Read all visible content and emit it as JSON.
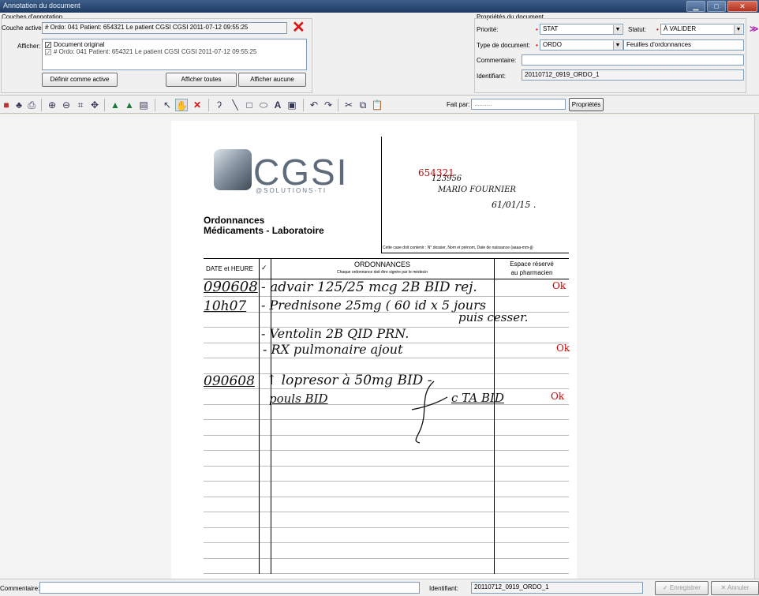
{
  "window": {
    "title": "Annotation du document"
  },
  "annotation": {
    "group_label": "Couches d'annotation",
    "active_layer_label": "Couche active:",
    "active_layer_value": "# Ordo: 041 Patient: 654321 Le patient CGSI CGSI 2011-07-12 09:55:25",
    "show_label": "Afficher:",
    "layers": [
      {
        "label": "Document original",
        "checked": true
      },
      {
        "label": "# Ordo: 041 Patient: 654321 Le patient CGSI CGSI 2011-07-12 09:55:25",
        "checked": true
      }
    ],
    "btn_set_active": "Définir comme active",
    "btn_show_all": "Afficher toutes",
    "btn_show_none": "Afficher aucune"
  },
  "properties": {
    "group_label": "Propriétés du document",
    "priority_label": "Priorité:",
    "priority_value": "STAT",
    "status_label": "Statut:",
    "status_value": "À VALIDER",
    "doctype_label": "Type de document:",
    "doctype_value": "ORDO",
    "doctype_desc": "Feuilles d'ordonnances",
    "comment_label": "Commentaire:",
    "comment_value": "",
    "identifier_label": "Identifiant:",
    "identifier_value": "20110712_0919_ORDO_1"
  },
  "toolbar": {
    "done_by_label": "Fait par:",
    "done_by_value": "..........",
    "properties_button": "Propriétés"
  },
  "document": {
    "logo_text": "CGSI",
    "logo_tagline": "@SOLUTIONS-TI",
    "heading_line1": "Ordonnances",
    "heading_line2": "Médicaments - Laboratoire",
    "patient_box_note": "Cette case doit contenir : N° dossier, Nom et prénom, Date de naissance (aaaa-mm-jj)",
    "patient_red_number": "654321",
    "patient_hw_number": "123956",
    "patient_hw_name": "MARIO FOURNIER",
    "patient_hw_date": "61/01/15 .",
    "col_date": "DATE et HEURE",
    "col_check": "✓",
    "col_orders_title": "ORDONNANCES",
    "col_orders_sub": "Chaque ordonnance doit être signée par le médecin",
    "col_pharma_line1": "Espace réservé",
    "col_pharma_line2": "au pharmacien",
    "hw_date1": "090608",
    "hw_time1": "10h07",
    "hw_date2": "090608",
    "hw_line1": "- advair 125/25 mcg 2B BID rej.",
    "hw_line2": "- Prednisone 25mg ( 60 id x 5 jours",
    "hw_line3": "puis cesser.",
    "hw_line4": "- Ventolin 2B QID PRN.",
    "hw_line5": "- RX pulmonaire ajout",
    "hw_line6": "↑ lopresor à 50mg BID -",
    "hw_line7": "pouls BID",
    "hw_line8": "c TA BID",
    "ok1": "Ok",
    "ok2": "Ok",
    "ok3": "Ok"
  },
  "bottom": {
    "comment_label": "Commentaire:",
    "comment_value": "",
    "identifier_label": "Identifiant:",
    "identifier_value": "20110712_0919_ORDO_1",
    "save_button": "Enregistrer",
    "cancel_button": "Annuler"
  },
  "colors": {
    "accent_red": "#cc0000",
    "titlebar": "#2b4a73"
  }
}
